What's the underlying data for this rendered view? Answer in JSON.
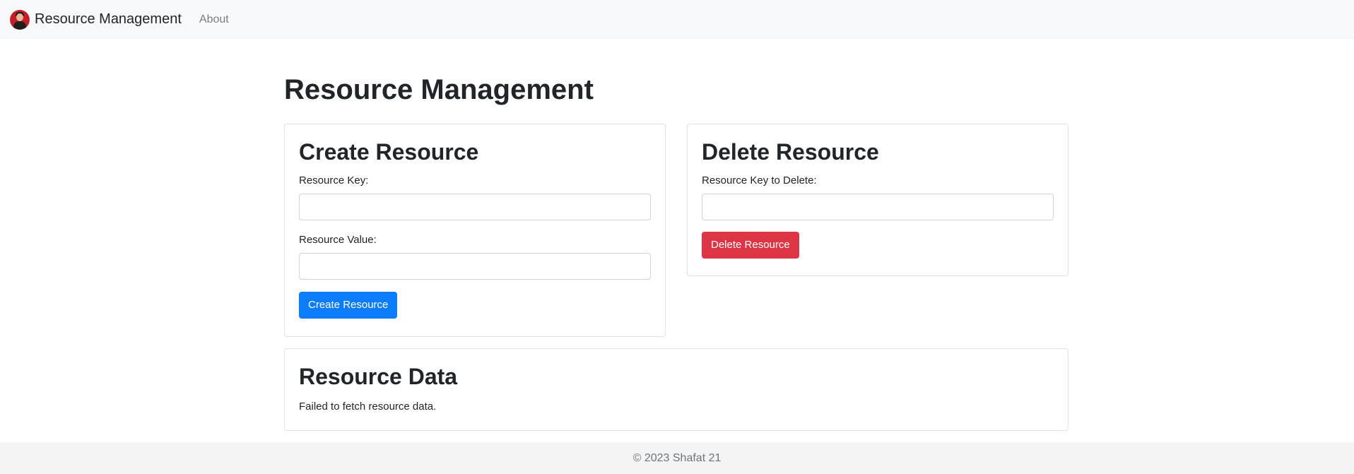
{
  "navbar": {
    "brand": "Resource Management",
    "links": [
      {
        "label": "About"
      }
    ]
  },
  "main": {
    "title": "Resource Management",
    "create_card": {
      "title": "Create Resource",
      "key_label": "Resource Key:",
      "key_value": "",
      "value_label": "Resource Value:",
      "value_value": "",
      "button_label": "Create Resource"
    },
    "delete_card": {
      "title": "Delete Resource",
      "key_label": "Resource Key to Delete:",
      "key_value": "",
      "button_label": "Delete Resource"
    },
    "data_card": {
      "title": "Resource Data",
      "message": "Failed to fetch resource data."
    }
  },
  "footer": {
    "text": "© 2023 Shafat 21"
  },
  "colors": {
    "primary": "#0b7cfc",
    "danger": "#dc3545",
    "navbar_bg": "#f8f9fa",
    "footer_bg": "#f4f4f4"
  }
}
